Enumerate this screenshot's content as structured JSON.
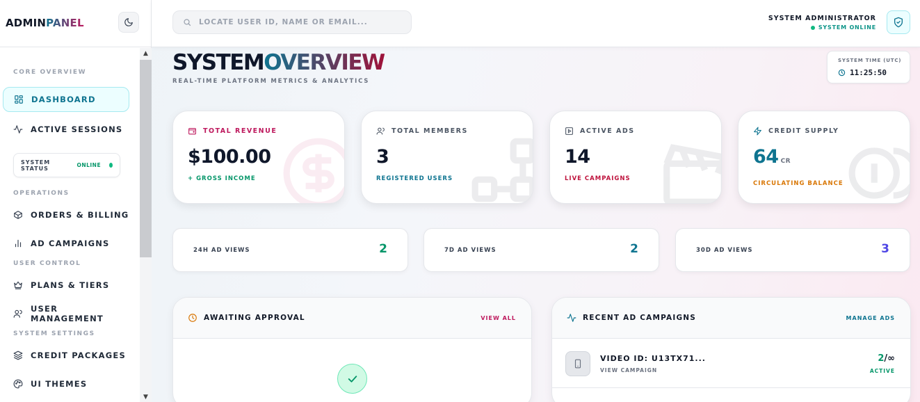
{
  "brand": {
    "part1": "ADMIN",
    "part2": "PANEL"
  },
  "sidebar": {
    "sections": [
      "CORE OVERVIEW",
      "OPERATIONS",
      "USER CONTROL",
      "SYSTEM SETTINGS"
    ],
    "items": [
      {
        "label": "DASHBOARD",
        "icon": "grid-icon",
        "active": true
      },
      {
        "label": "ACTIVE SESSIONS",
        "icon": "activity-icon"
      },
      {
        "label": "ORDERS & BILLING",
        "icon": "box-icon"
      },
      {
        "label": "AD CAMPAIGNS",
        "icon": "bar-chart-icon"
      },
      {
        "label": "PLANS & TIERS",
        "icon": "crown-icon"
      },
      {
        "label": "USER MANAGEMENT",
        "icon": "users-icon"
      },
      {
        "label": "CREDIT PACKAGES",
        "icon": "layers-icon"
      },
      {
        "label": "UI THEMES",
        "icon": "palette-icon"
      }
    ],
    "system_status": {
      "label": "SYSTEM STATUS",
      "value": "ONLINE"
    }
  },
  "header": {
    "search_placeholder": "LOCATE USER ID, NAME OR EMAIL...",
    "user_name": "SYSTEM ADMINISTRATOR",
    "user_status": "SYSTEM ONLINE"
  },
  "page": {
    "title_part1": "SYSTEM",
    "title_part2": "OVERVIEW",
    "subtitle": "REAL-TIME PLATFORM METRICS & ANALYTICS",
    "time_label": "SYSTEM TIME (UTC)",
    "time_value": "11:25:50"
  },
  "stats": [
    {
      "label": "TOTAL REVENUE",
      "value": "$100.00",
      "unit": "",
      "sub": "+ GROSS INCOME",
      "color": "#be185d",
      "sub_color": "#059669"
    },
    {
      "label": "TOTAL MEMBERS",
      "value": "3",
      "unit": "",
      "sub": "REGISTERED USERS",
      "color": "#4b5563",
      "sub_color": "#0e7490"
    },
    {
      "label": "ACTIVE ADS",
      "value": "14",
      "unit": "",
      "sub": "LIVE CAMPAIGNS",
      "color": "#4b5563",
      "sub_color": "#be123c"
    },
    {
      "label": "CREDIT SUPPLY",
      "value": "64",
      "unit": "CR",
      "sub": "CIRCULATING BALANCE",
      "color": "#0e7490",
      "sub_color": "#d97706"
    }
  ],
  "views": [
    {
      "label": "24H AD VIEWS",
      "value": "2",
      "color": "#059669"
    },
    {
      "label": "7D AD VIEWS",
      "value": "2",
      "color": "#0e7490"
    },
    {
      "label": "30D AD VIEWS",
      "value": "3",
      "color": "#4f46e5"
    }
  ],
  "approval": {
    "title": "AWAITING APPROVAL",
    "link": "VIEW ALL"
  },
  "campaigns": {
    "title": "RECENT AD CAMPAIGNS",
    "link": "MANAGE ADS",
    "rows": [
      {
        "title": "VIDEO ID: U13TX71...",
        "sub": "VIEW CAMPAIGN",
        "count": "2",
        "sep": "/",
        "limit": "∞",
        "state": "ACTIVE"
      }
    ]
  }
}
